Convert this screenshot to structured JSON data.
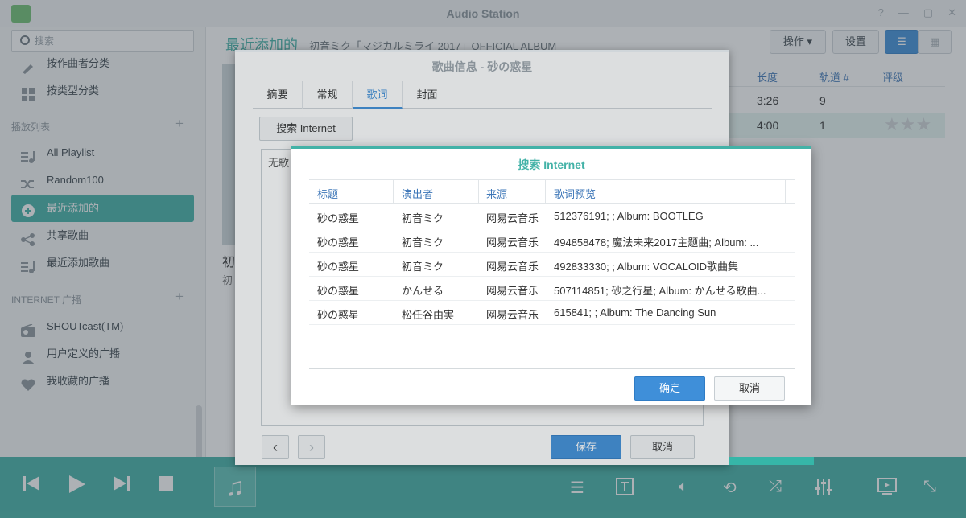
{
  "app": {
    "title": "Audio Station",
    "window_buttons": [
      "?",
      "—",
      "▢",
      "✕"
    ]
  },
  "sidebar": {
    "search_placeholder": "搜索",
    "items_top": [
      {
        "label": "按作曲者分类",
        "icon": "composer-icon"
      },
      {
        "label": "按类型分类",
        "icon": "genre-icon"
      }
    ],
    "playlist_section": "播放列表",
    "playlists": [
      {
        "label": "All Playlist",
        "icon": "playlist-icon"
      },
      {
        "label": "Random100",
        "icon": "shuffle-icon"
      },
      {
        "label": "最近添加的",
        "icon": "add-circle-icon",
        "active": true
      },
      {
        "label": "共享歌曲",
        "icon": "share-icon"
      },
      {
        "label": "最近添加歌曲",
        "icon": "playlist-icon"
      }
    ],
    "radio_section": "INTERNET 广播",
    "radios": [
      {
        "label": "SHOUTcast(TM)",
        "icon": "radio-icon"
      },
      {
        "label": "用户定义的广播",
        "icon": "user-icon"
      },
      {
        "label": "我收藏的广播",
        "icon": "heart-icon"
      }
    ]
  },
  "main": {
    "title": "最近添加的",
    "subtitle": "初音ミク「マジカルミライ 2017」OFFICIAL ALBUM",
    "actions_label": "操作",
    "settings_label": "设置",
    "columns": [
      "长度",
      "轨道 #",
      "评级"
    ],
    "rows": [
      {
        "length": "3:26",
        "track": "9"
      },
      {
        "length": "4:00",
        "track": "1"
      }
    ],
    "album_labels": [
      "初",
      "初"
    ]
  },
  "song_dialog": {
    "title": "歌曲信息 - 砂の惑星",
    "tabs": [
      "摘要",
      "常规",
      "歌词",
      "封面"
    ],
    "active_tab": "歌词",
    "search_button": "搜索 Internet",
    "lyrics_text": "无歌",
    "save_label": "保存",
    "cancel_label": "取消"
  },
  "search_dialog": {
    "title": "搜索 Internet",
    "columns": [
      "标题",
      "演出者",
      "来源",
      "歌词预览"
    ],
    "results": [
      {
        "title": "砂の惑星",
        "artist": "初音ミク",
        "source": "网易云音乐",
        "preview": "512376191; ; Album: BOOTLEG"
      },
      {
        "title": "砂の惑星",
        "artist": "初音ミク",
        "source": "网易云音乐",
        "preview": "494858478; 魔法未来2017主题曲; Album: ..."
      },
      {
        "title": "砂の惑星",
        "artist": "初音ミク",
        "source": "网易云音乐",
        "preview": "492833330; ; Album: VOCALOID歌曲集"
      },
      {
        "title": "砂の惑星",
        "artist": "かんせる",
        "source": "网易云音乐",
        "preview": "507114851; 砂之行星; Album: かんせる歌曲..."
      },
      {
        "title": "砂の惑星",
        "artist": "松任谷由実",
        "source": "网易云音乐",
        "preview": "615841; ; Album: The Dancing Sun"
      }
    ],
    "ok_label": "确定",
    "cancel_label": "取消"
  }
}
